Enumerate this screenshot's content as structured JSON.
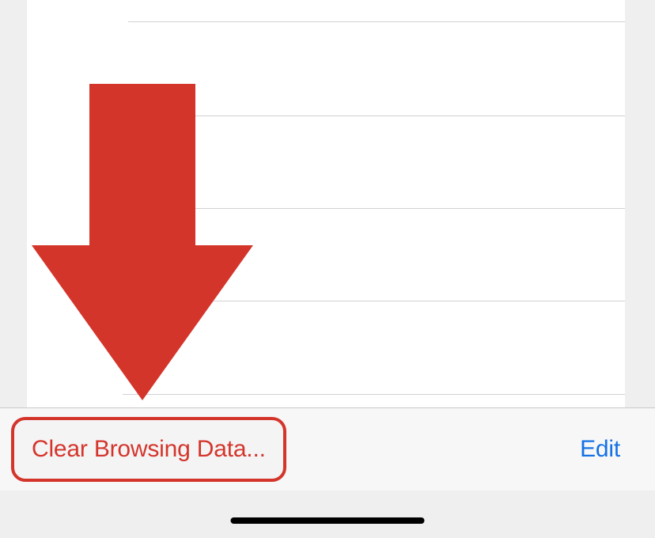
{
  "toolbar": {
    "clear_label": "Clear Browsing Data...",
    "edit_label": "Edit"
  },
  "annotation": {
    "arrow_color": "#d4352b"
  },
  "list": {
    "line_positions": [
      27,
      146,
      263,
      380,
      498
    ]
  }
}
